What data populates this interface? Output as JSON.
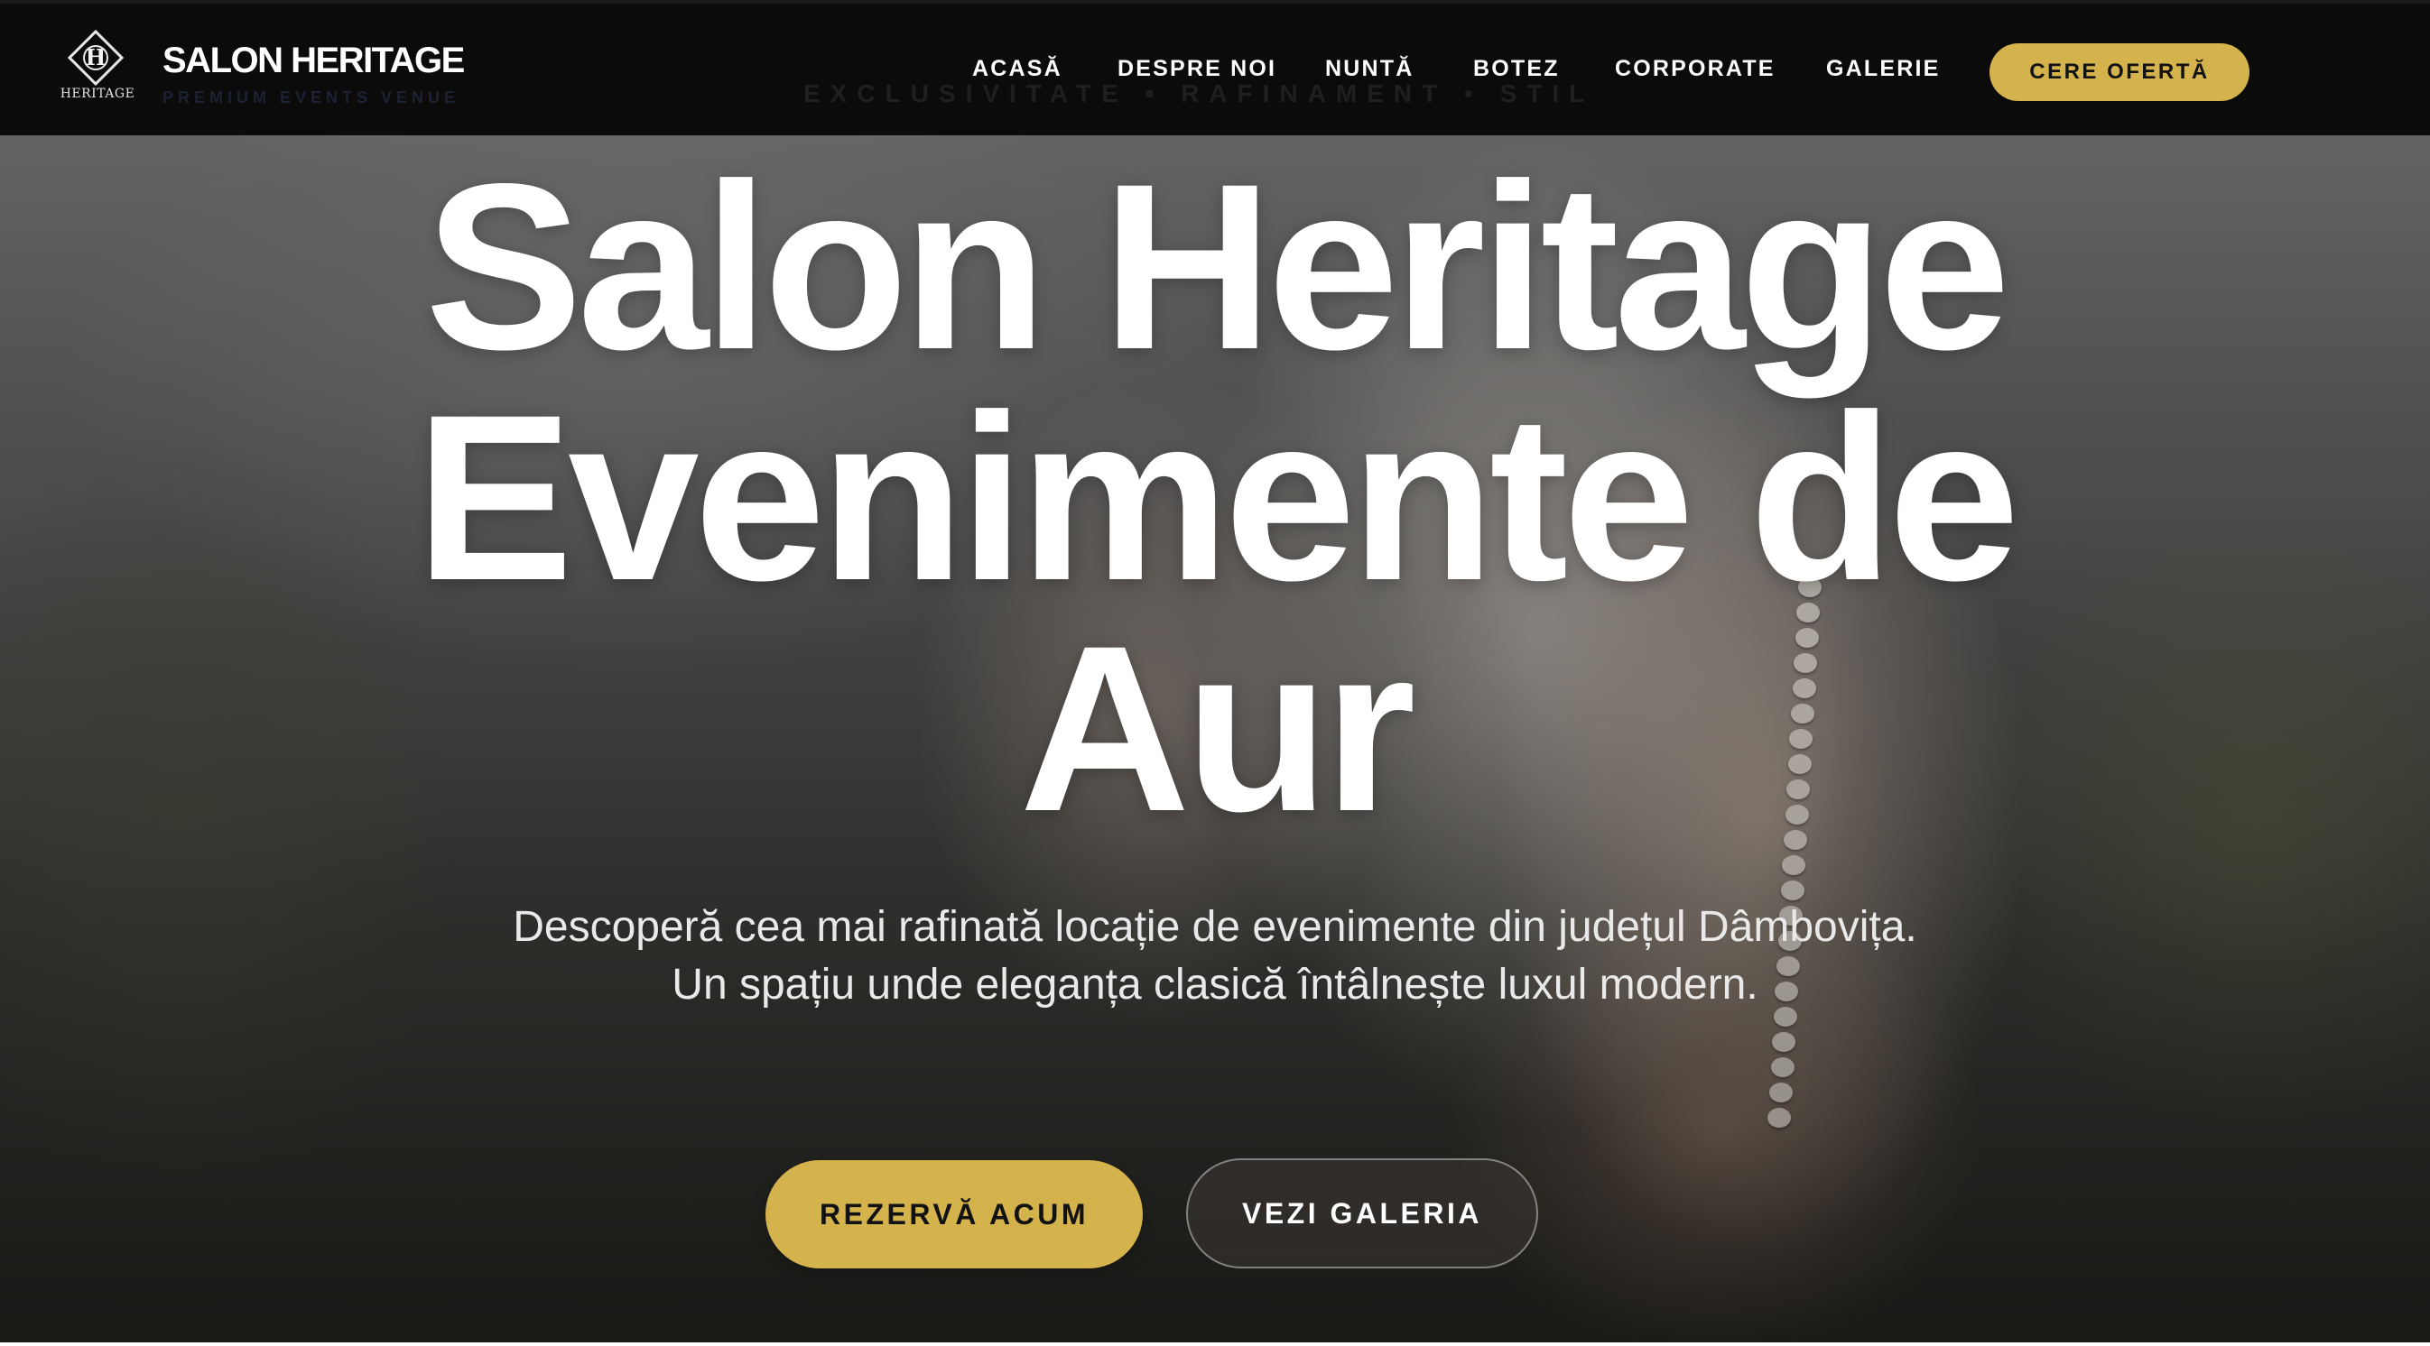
{
  "brand": {
    "emblem_letter": "H",
    "emblem_word": "HERITAGE",
    "name": "SALON HERITAGE",
    "tagline": "PREMIUM EVENTS VENUE"
  },
  "header_ghost_text": "EXCLUSIVITATE • RAFINAMENT • STIL",
  "nav": {
    "items": [
      {
        "label": "ACASĂ"
      },
      {
        "label": "DESPRE NOI"
      },
      {
        "label": "NUNTĂ"
      },
      {
        "label": "BOTEZ"
      },
      {
        "label": "CORPORATE"
      },
      {
        "label": "GALERIE"
      }
    ],
    "cta_label": "CERE OFERTĂ"
  },
  "hero": {
    "title_lines": [
      "Salon Heritage",
      "Evenimente de",
      "Aur"
    ],
    "subtitle": "Descoperă cea mai rafinată locație de evenimente din județul Dâmbovița. Un spațiu unde eleganța clasică întâlnește luxul modern.",
    "primary_button": "REZERVĂ ACUM",
    "secondary_button": "VEZI GALERIA"
  },
  "colors": {
    "accent_gold": "#d4b24c",
    "nav_background": "#0b0b0b",
    "text_white": "#ffffff"
  }
}
